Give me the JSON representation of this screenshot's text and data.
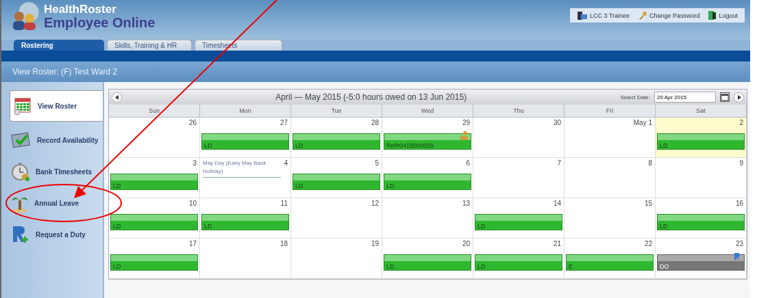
{
  "header": {
    "brand_top": "HealthRoster",
    "brand_bottom": "Employee Online",
    "links": [
      {
        "label": "LCC 3 Trainee",
        "kind": "user"
      },
      {
        "label": "Change Password",
        "kind": "password"
      },
      {
        "label": "Logout",
        "kind": "logout"
      }
    ]
  },
  "tabs": [
    {
      "label": "Rostering",
      "selected": true
    },
    {
      "label": "Skills, Training & HR",
      "selected": false
    },
    {
      "label": "Timesheets",
      "selected": false
    }
  ],
  "page_title": "View Roster: (F) Test Ward 2",
  "sidebar": {
    "items": [
      {
        "label": "View Roster",
        "kind": "calendar",
        "selected": true
      },
      {
        "label": "Record Availability",
        "kind": "check",
        "selected": false
      },
      {
        "label": "Bank Timesheets",
        "kind": "clock",
        "selected": false
      },
      {
        "label": "Annual Leave",
        "kind": "palm",
        "selected": false
      },
      {
        "label": "Request a Duty",
        "kind": "request",
        "selected": false
      }
    ]
  },
  "calendar": {
    "title": "April — May 2015 (-5:0 hours owed on 13 Jun 2015)",
    "select_date_label": "Select Date:",
    "select_date_value": "20 Apr 2015",
    "weekdays": [
      "Sun",
      "Mon",
      "Tue",
      "Wed",
      "Thu",
      "Fri",
      "Sat"
    ],
    "weeks": [
      [
        {
          "date": "26",
          "today": false
        },
        {
          "date": "27",
          "today": false,
          "shift": {
            "label": "LD",
            "kind": "duty"
          }
        },
        {
          "date": "28",
          "today": false,
          "shift": {
            "label": "LD",
            "kind": "duty"
          }
        },
        {
          "date": "29",
          "today": false,
          "shift": {
            "label": "Ref#0415000029",
            "kind": "request"
          }
        },
        {
          "date": "30",
          "today": false
        },
        {
          "date": "May 1",
          "today": false
        },
        {
          "date": "2",
          "today": true,
          "shift": {
            "label": "LD",
            "kind": "duty"
          }
        }
      ],
      [
        {
          "date": "3",
          "today": false,
          "shift": {
            "label": "LD",
            "kind": "duty"
          }
        },
        {
          "date": "4",
          "today": false,
          "note": "May Day (Early May Bank Holiday)"
        },
        {
          "date": "5",
          "today": false,
          "shift": {
            "label": "LD",
            "kind": "duty"
          }
        },
        {
          "date": "6",
          "today": false,
          "shift": {
            "label": "LD",
            "kind": "duty"
          }
        },
        {
          "date": "7",
          "today": false
        },
        {
          "date": "8",
          "today": false
        },
        {
          "date": "9",
          "today": false
        }
      ],
      [
        {
          "date": "10",
          "today": false,
          "shift": {
            "label": "LD",
            "kind": "duty"
          }
        },
        {
          "date": "11",
          "today": false,
          "shift": {
            "label": "LD",
            "kind": "duty"
          }
        },
        {
          "date": "12",
          "today": false
        },
        {
          "date": "13",
          "today": false
        },
        {
          "date": "14",
          "today": false,
          "shift": {
            "label": "LD",
            "kind": "duty"
          }
        },
        {
          "date": "15",
          "today": false
        },
        {
          "date": "16",
          "today": false,
          "shift": {
            "label": "LD",
            "kind": "duty"
          }
        }
      ],
      [
        {
          "date": "17",
          "today": false,
          "shift": {
            "label": "LD",
            "kind": "duty"
          }
        },
        {
          "date": "18",
          "today": false
        },
        {
          "date": "19",
          "today": false
        },
        {
          "date": "20",
          "today": false,
          "shift": {
            "label": "LD",
            "kind": "duty"
          }
        },
        {
          "date": "21",
          "today": false,
          "shift": {
            "label": "LD",
            "kind": "duty"
          }
        },
        {
          "date": "22",
          "today": false,
          "shift": {
            "label": "E",
            "kind": "duty"
          }
        },
        {
          "date": "23",
          "today": false,
          "shift": {
            "label": "DO",
            "kind": "rest"
          }
        }
      ]
    ]
  }
}
